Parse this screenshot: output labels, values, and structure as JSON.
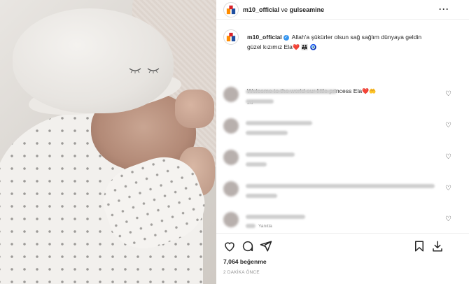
{
  "post": {
    "author": "m10_official",
    "joiner": "ve",
    "collaborator": "gulseamine",
    "more_icon": "more-horizontal-icon"
  },
  "caption": {
    "author": "m10_official",
    "text_tr_1": "Allah'a şükürler olsun sağ sağlım dünyaya geldin",
    "text_tr_2": "güzel kızımız Ela",
    "emoji_1": "❤️",
    "emoji_2": "👨‍👩‍👧",
    "emoji_3": "🧿",
    "text_en": "Welcome to the world our little princess Ela",
    "emoji_4": "❤️",
    "emoji_5": "🤲",
    "time": "2d"
  },
  "comments": [
    {
      "blurred": true,
      "sub": ""
    },
    {
      "blurred": true,
      "sub": ""
    },
    {
      "blurred": true,
      "sub": ""
    },
    {
      "blurred": true,
      "sub": ""
    },
    {
      "blurred": true,
      "sub": "Yanıtla"
    }
  ],
  "stats": {
    "likes": "7,064 beğenme",
    "ago": "2 DAKİKA ÖNCE"
  },
  "colors": {
    "verified": "#3897f0",
    "text": "#262626",
    "muted": "#8e8e8e"
  },
  "icons": [
    "heart-icon",
    "comment-icon",
    "share-icon",
    "bookmark-icon",
    "download-icon"
  ]
}
